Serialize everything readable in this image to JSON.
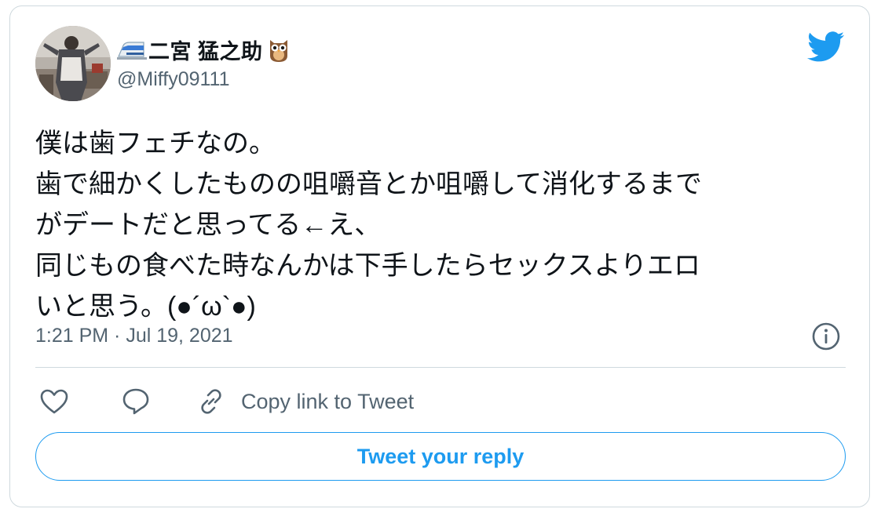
{
  "author": {
    "display_name": "二宮 猛之助",
    "name_prefix_emoji": "bullet-train-emoji",
    "name_suffix_emoji": "owl-emoji",
    "handle": "@Miffy09111",
    "avatar": "user-avatar-photo"
  },
  "brand": {
    "logo": "twitter-bird-icon",
    "accent_color": "#1d9bf0"
  },
  "tweet": {
    "lines": [
      "僕は歯フェチなの。",
      "歯で細かくしたものの咀嚼音とか咀嚼して消化するまで",
      "がデートだと思ってる←え、",
      "同じもの食べた時なんかは下手したらセックスよりエロ",
      "いと思う。(●´ω`●)"
    ],
    "timestamp": "1:21 PM · Jul 19, 2021",
    "info_icon": "info-icon"
  },
  "actions": {
    "like_icon": "heart-icon",
    "reply_icon": "speech-bubble-icon",
    "copy_icon": "link-icon",
    "copy_label": "Copy link to Tweet"
  },
  "reply_button": {
    "label": "Tweet your reply"
  },
  "colors": {
    "text_primary": "#0f1419",
    "text_secondary": "#536471",
    "border": "#cfd9de"
  }
}
